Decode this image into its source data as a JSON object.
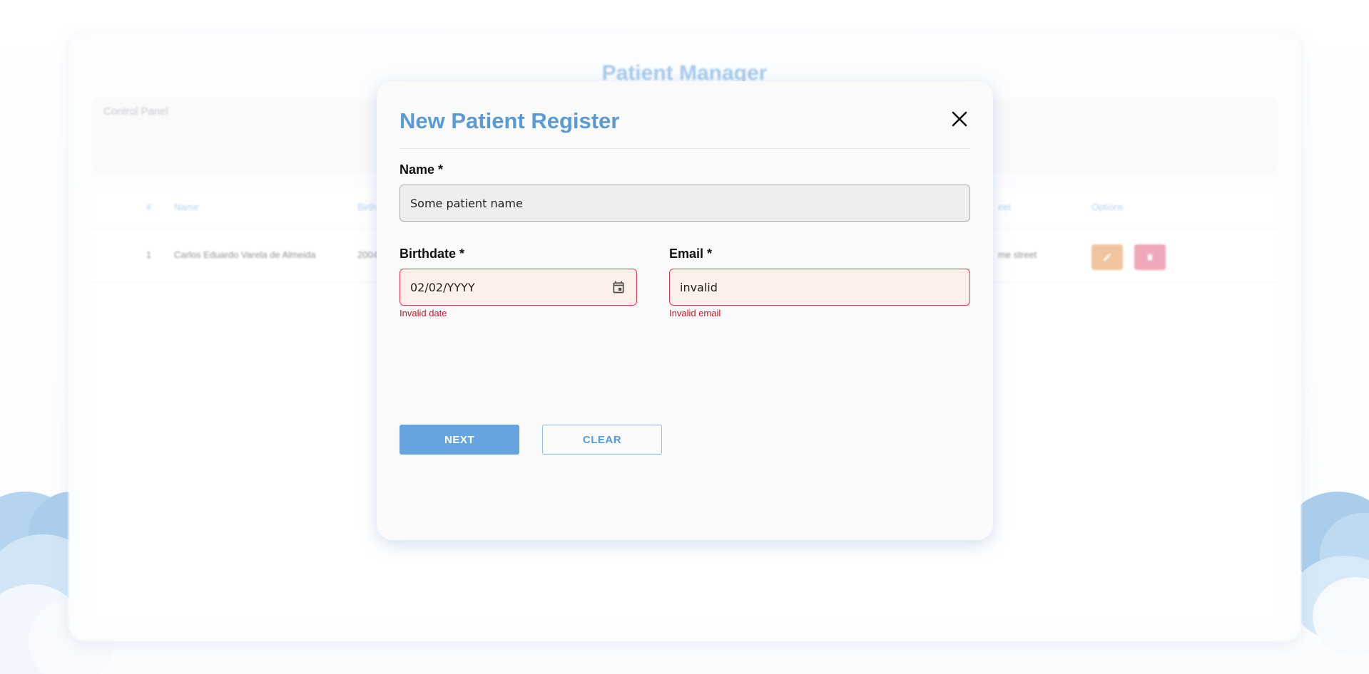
{
  "background_app": {
    "title": "Patient Manager",
    "control_panel_title": "Control Panel",
    "table": {
      "headers": [
        "#",
        "Name",
        "Birth",
        "eet",
        "Options"
      ],
      "rows": [
        {
          "index": "1",
          "name": "Carlos Eduardo Varela de Almeida",
          "birth": "2004",
          "street": "me street"
        }
      ]
    }
  },
  "modal": {
    "title": "New Patient Register",
    "name_field": {
      "label": "Name *",
      "value": "Some patient name"
    },
    "birthdate_field": {
      "label": "Birthdate *",
      "value": "02/02/YYYY",
      "error": "Invalid date"
    },
    "email_field": {
      "label": "Email *",
      "value": "invalid",
      "error": "Invalid email"
    },
    "next_label": "NEXT",
    "clear_label": "CLEAR"
  },
  "icons": {
    "close": "close-icon",
    "calendar": "calendar-icon",
    "edit": "pencil-icon",
    "delete": "trash-icon"
  },
  "colors": {
    "primary": "#5b9ad6",
    "error": "#c8142b",
    "edit": "#e6a56c",
    "delete": "#e77a94"
  }
}
